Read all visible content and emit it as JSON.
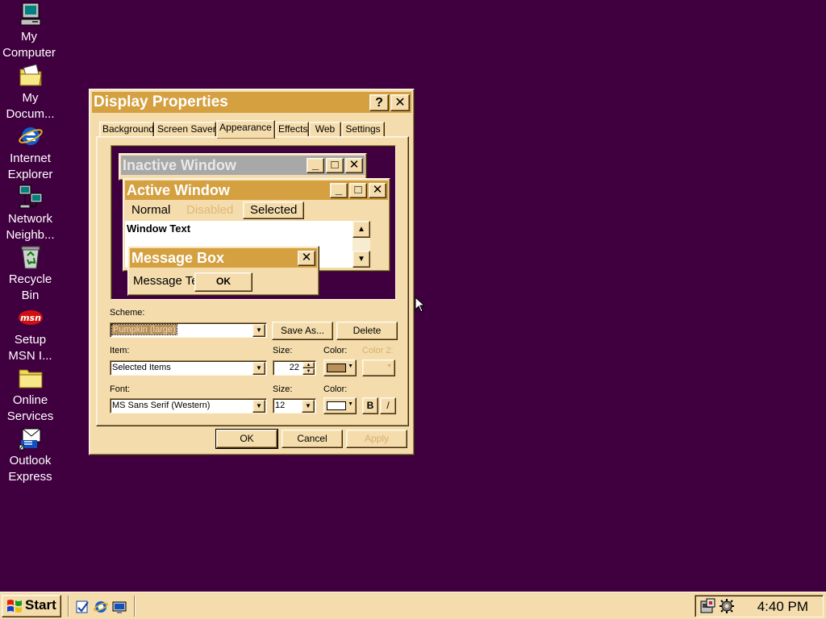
{
  "desktop": {
    "icons": [
      {
        "label": "My Computer",
        "icon": "my-computer-icon"
      },
      {
        "label": "My Docum...",
        "icon": "my-documents-icon"
      },
      {
        "label": "Internet Explorer",
        "icon": "internet-explorer-icon"
      },
      {
        "label": "Network Neighb...",
        "icon": "network-neighborhood-icon"
      },
      {
        "label": "Recycle Bin",
        "icon": "recycle-bin-icon"
      },
      {
        "label": "Setup MSN I...",
        "icon": "msn-icon"
      },
      {
        "label": "Online Services",
        "icon": "folder-icon"
      },
      {
        "label": "Outlook Express",
        "icon": "outlook-express-icon"
      }
    ]
  },
  "dialog": {
    "title": "Display Properties",
    "help_glyph": "?",
    "close_glyph": "✕",
    "tabs": [
      "Background",
      "Screen Saver",
      "Appearance",
      "Effects",
      "Web",
      "Settings"
    ],
    "active_tab": "Appearance",
    "preview": {
      "inactive_title": "Inactive Window",
      "active_title": "Active Window",
      "menu_normal": "Normal",
      "menu_disabled": "Disabled",
      "menu_selected": "Selected",
      "window_text": "Window Text",
      "msgbox_title": "Message Box",
      "msgbox_text": "Message Text",
      "msgbox_ok": "OK"
    },
    "scheme_label": "Scheme:",
    "scheme_value": "Pumpkin (large)",
    "save_as": "Save As...",
    "delete": "Delete",
    "item_label": "Item:",
    "item_value": "Selected Items",
    "size_label": "Size:",
    "item_size": "22",
    "color_label": "Color:",
    "color2_label": "Color 2:",
    "font_label": "Font:",
    "font_value": "MS Sans Serif (Western)",
    "font_size_label": "Size:",
    "font_size": "12",
    "font_color_label": "Color:",
    "bold": "B",
    "italic": "/",
    "ok": "OK",
    "cancel": "Cancel",
    "apply": "Apply"
  },
  "taskbar": {
    "start": "Start",
    "clock": "4:40 PM"
  },
  "colors": {
    "desktop": "#400040",
    "face": "#f4dcac",
    "active_title": "#d4a040",
    "inactive_title": "#a8a8a8",
    "selected_item_color": "#b8905a",
    "disabled_text": "#d8b070"
  }
}
